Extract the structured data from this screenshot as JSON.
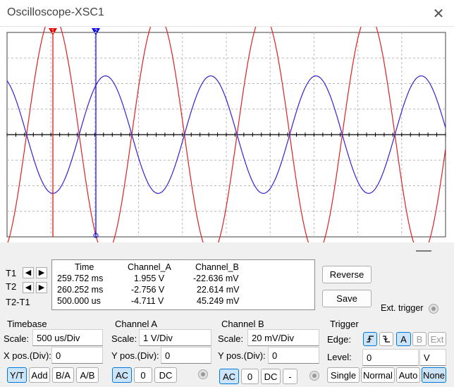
{
  "window": {
    "title": "Oscilloscope-XSC1",
    "close_glyph": "✕"
  },
  "cursors": {
    "t1_label": "T1",
    "t2_label": "T2",
    "diff_label": "T2-T1",
    "t1_marker": "1",
    "t2_marker": "2",
    "t1_color": "#e00000",
    "t2_color": "#0000e0"
  },
  "readout": {
    "headers": [
      "Time",
      "Channel_A",
      "Channel_B"
    ],
    "rows": [
      [
        "259.752 ms",
        "1.955 V",
        "-22.636 mV"
      ],
      [
        "260.252 ms",
        "-2.756 V",
        "22.614 mV"
      ],
      [
        "500.000 us",
        "-4.711 V",
        "45.249 mV"
      ]
    ]
  },
  "buttons": {
    "reverse": "Reverse",
    "save": "Save",
    "ext_trigger": "Ext. trigger"
  },
  "timebase": {
    "title": "Timebase",
    "scale_label": "Scale:",
    "scale_value": "500 us/Div",
    "xpos_label": "X pos.(Div):",
    "xpos_value": "0",
    "modes": [
      "Y/T",
      "Add",
      "B/A",
      "A/B"
    ],
    "selected_mode": "Y/T"
  },
  "channel_a": {
    "title": "Channel A",
    "scale_label": "Scale:",
    "scale_value": "1  V/Div",
    "ypos_label": "Y pos.(Div):",
    "ypos_value": "0",
    "coupling": [
      "AC",
      "0",
      "DC"
    ],
    "selected_coupling": "AC",
    "trace_color": "#e02020"
  },
  "channel_b": {
    "title": "Channel B",
    "scale_label": "Scale:",
    "scale_value": "20 mV/Div",
    "ypos_label": "Y pos.(Div):",
    "ypos_value": "0",
    "coupling": [
      "AC",
      "0",
      "DC",
      "-"
    ],
    "selected_coupling": "AC",
    "trace_color": "#3a20d0"
  },
  "trigger": {
    "title": "Trigger",
    "edge_label": "Edge:",
    "edge_rising_icon": "rising-edge-icon",
    "edge_falling_icon": "falling-edge-icon",
    "sources": [
      "A",
      "B",
      "Ext"
    ],
    "selected_source": "A",
    "level_label": "Level:",
    "level_value": "0",
    "level_unit": "V",
    "modes": [
      "Single",
      "Normal",
      "Auto",
      "None"
    ],
    "selected_mode": "None"
  },
  "chart_data": {
    "type": "line",
    "xlabel": "",
    "ylabel": "",
    "time_per_div_us": 500,
    "horizontal_divisions": 10,
    "vertical_divisions": 8,
    "grid": true,
    "series": [
      {
        "name": "Channel_A",
        "color": "#e02020",
        "amplitude_div": 4.7,
        "period_div": 2.4,
        "phase_at_t1": "peak"
      },
      {
        "name": "Channel_B",
        "color": "#3a20d0",
        "amplitude_div": 2.3,
        "period_div": 2.4,
        "phase_at_t1": "trough"
      }
    ]
  }
}
